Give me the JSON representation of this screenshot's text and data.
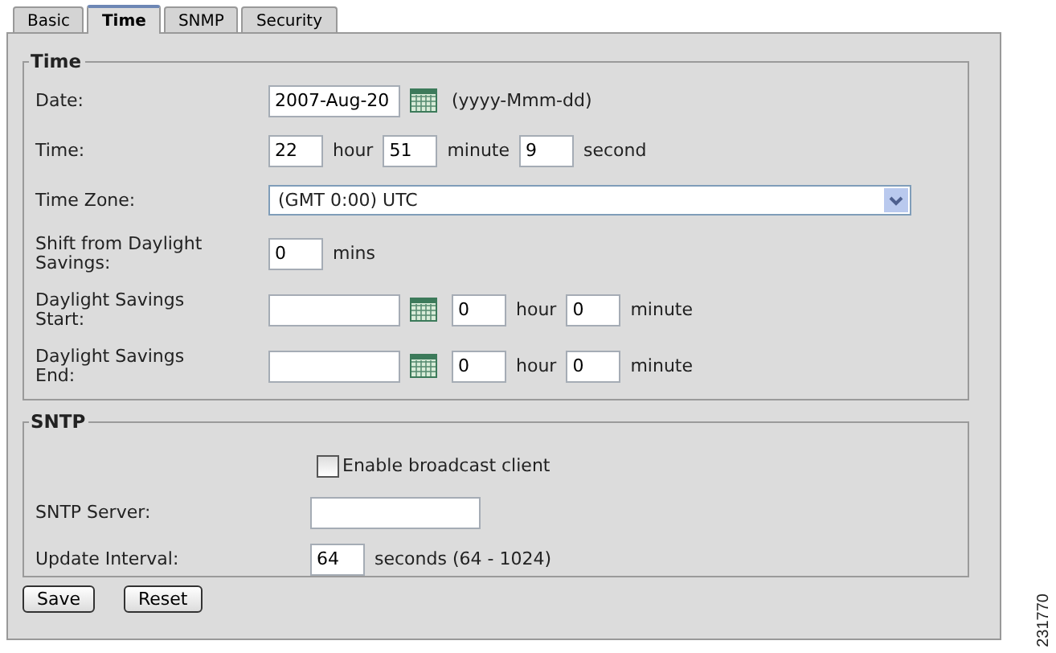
{
  "tabs": [
    {
      "label": "Basic",
      "selected": false
    },
    {
      "label": "Time",
      "selected": true
    },
    {
      "label": "SNMP",
      "selected": false
    },
    {
      "label": "Security",
      "selected": false
    }
  ],
  "sections": [
    {
      "title": "Time",
      "rows": [
        {
          "label": "Date:",
          "controls": [
            {
              "kind": "date_field",
              "value": "2007-Aug-20"
            },
            {
              "kind": "text",
              "text": "(yyyy-Mmm-dd)"
            }
          ]
        },
        {
          "label": "Time:",
          "controls": [
            {
              "kind": "number_field",
              "value": "22"
            },
            {
              "kind": "text",
              "text": "hour"
            },
            {
              "kind": "number_field",
              "value": "51"
            },
            {
              "kind": "text",
              "text": "minute"
            },
            {
              "kind": "number_field",
              "value": "9"
            },
            {
              "kind": "text",
              "text": "second"
            }
          ]
        },
        {
          "label": "Time Zone:",
          "controls": [
            {
              "kind": "select",
              "value": "(GMT 0:00) UTC"
            }
          ]
        },
        {
          "label": "Shift from Daylight Savings:",
          "controls": [
            {
              "kind": "number_field",
              "value": "0"
            },
            {
              "kind": "text",
              "text": "mins"
            }
          ]
        },
        {
          "label": "Daylight Savings Start:",
          "controls": [
            {
              "kind": "date_field"
            },
            {
              "kind": "number_field",
              "value": "0"
            },
            {
              "kind": "text",
              "text": "hour"
            },
            {
              "kind": "number_field",
              "value": "0"
            },
            {
              "kind": "text",
              "text": "minute"
            }
          ]
        },
        {
          "label": "Daylight Savings End:",
          "controls": [
            {
              "kind": "date_field"
            },
            {
              "kind": "number_field",
              "value": "0"
            },
            {
              "kind": "text",
              "text": "hour"
            },
            {
              "kind": "number_field",
              "value": "0"
            },
            {
              "kind": "text",
              "text": "minute"
            }
          ]
        }
      ]
    },
    {
      "title": "SNTP",
      "rows": [
        {
          "controls": [
            {
              "kind": "checkbox",
              "text": "Enable broadcast client",
              "checked": false
            }
          ]
        },
        {
          "label": "SNTP Server:",
          "controls": [
            {
              "kind": "text_field"
            }
          ]
        },
        {
          "label": "Update Interval:",
          "controls": [
            {
              "kind": "number_field",
              "value": "64"
            },
            {
              "kind": "text",
              "text": "seconds (64 - 1024)"
            }
          ]
        }
      ]
    }
  ],
  "buttons": [
    "Save",
    "Reset"
  ],
  "figure_number": "231770"
}
